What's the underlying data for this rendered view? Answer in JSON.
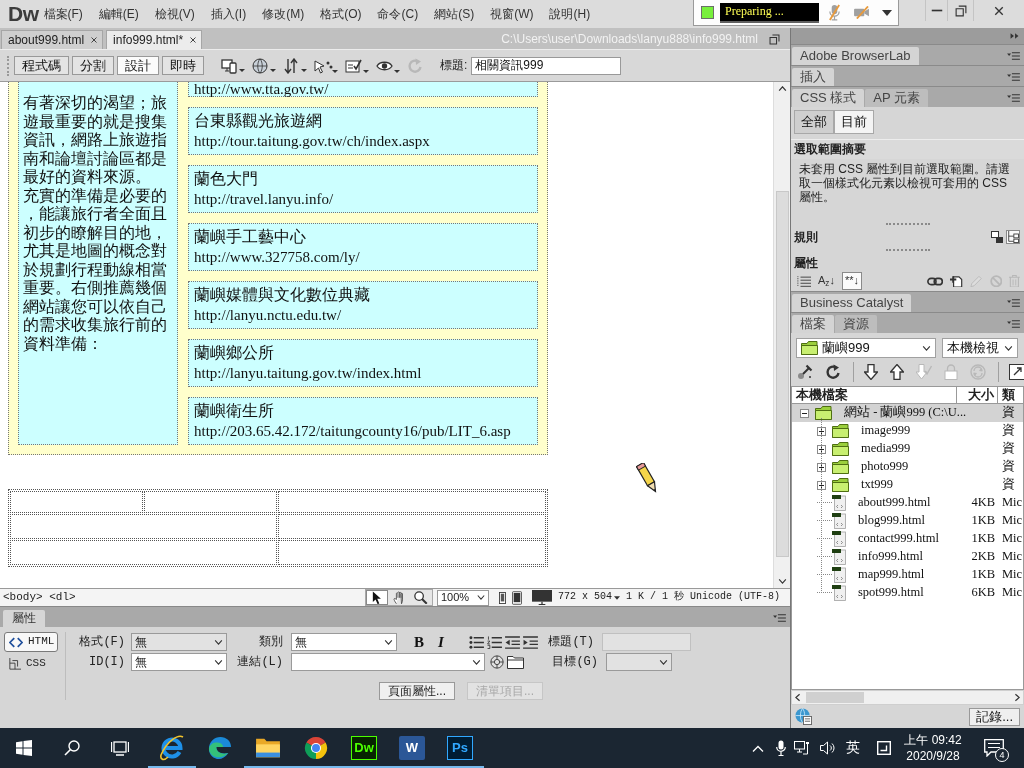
{
  "menubar": {
    "logo": "Dw",
    "items": [
      "檔案(F)",
      "編輯(E)",
      "檢視(V)",
      "插入(I)",
      "修改(M)",
      "格式(O)",
      "命令(C)",
      "網站(S)",
      "視窗(W)",
      "說明(H)"
    ]
  },
  "recorder": {
    "status": "Preparing ..."
  },
  "document_tabs": [
    {
      "label": "about999.html",
      "selected": false
    },
    {
      "label": "info999.html*",
      "selected": true
    }
  ],
  "document_path": "C:\\Users\\user\\Downloads\\lanyu888\\info999.html",
  "document_toolbar": {
    "views": [
      {
        "label": "程式碼",
        "selected": false
      },
      {
        "label": "分割",
        "selected": false
      },
      {
        "label": "設計",
        "selected": true
      },
      {
        "label": "即時",
        "selected": false
      }
    ],
    "tools": [
      {
        "kind": "devices",
        "disabled": false
      },
      {
        "kind": "globe",
        "disabled": false
      },
      {
        "kind": "transfer",
        "disabled": false
      },
      {
        "kind": "inspect",
        "disabled": false
      },
      {
        "kind": "validate",
        "disabled": false
      },
      {
        "kind": "eye",
        "disabled": false
      },
      {
        "kind": "refresh",
        "disabled": true
      }
    ],
    "title_label": "標題:",
    "title_value": "相關資訊999"
  },
  "page": {
    "intro": [
      "有著深切的渴望；旅遊最重要的就是搜集資訊，網路上旅遊指南和論壇討論區都是最好的資料來源。",
      "充實的準備是必要的，能讓旅行者全面且初步的瞭解目的地，尤其是地圖的概念對於規劃行程動線相當重要。右側推薦幾個網站讓您可以依自己的需求收集旅行前的資料準備："
    ],
    "links": [
      {
        "url": "http://www.tta.gov.tw/"
      },
      {
        "title": "台東縣觀光旅遊網",
        "url": "http://tour.taitung.gov.tw/ch/index.aspx"
      },
      {
        "title": "蘭色大門",
        "url": "http://travel.lanyu.info/"
      },
      {
        "title": "蘭嶼手工藝中心",
        "url": "http://www.327758.com/ly/"
      },
      {
        "title": "蘭嶼媒體與文化數位典藏",
        "url": "http://lanyu.nctu.edu.tw/"
      },
      {
        "title": "蘭嶼鄉公所",
        "url": "http://lanyu.taitung.gov.tw/index.html"
      },
      {
        "title": "蘭嶼衛生所",
        "url": "http://203.65.42.172/taitungcounty16/pub/LIT_6.asp"
      }
    ]
  },
  "status_bar": {
    "tag_path": "<body> <dl>",
    "tools": [
      {
        "kind": "pointer",
        "selected": true
      },
      {
        "kind": "hand",
        "selected": false
      },
      {
        "kind": "zoom",
        "selected": false
      }
    ],
    "zoom": "100%",
    "window_size": "772 x 504",
    "stats": "1 K / 1 秒",
    "encoding": "Unicode (UTF-8)"
  },
  "properties": {
    "title": "屬性",
    "modes": [
      {
        "kind": "html",
        "label": "HTML",
        "selected": true
      },
      {
        "kind": "css",
        "label": "CSS",
        "selected": false
      }
    ],
    "format": {
      "label": "格式(F)",
      "value": "無",
      "disabled": true
    },
    "id": {
      "label": "ID(I)",
      "value": "無",
      "disabled": false
    },
    "class": {
      "label": "類別",
      "value": "無"
    },
    "link": {
      "label": "連結(L)"
    },
    "bold": "B",
    "italic": "I",
    "heading": {
      "label": "標題(T)",
      "disabled": true
    },
    "target": {
      "label": "目標(G)",
      "disabled": true
    },
    "buttons": [
      {
        "label": "頁面屬性...",
        "disabled": false
      },
      {
        "label": "清單項目...",
        "disabled": true
      }
    ]
  },
  "panel_headers": [
    "Adobe BrowserLab",
    "插入"
  ],
  "css_panel": {
    "tabs": [
      {
        "label": "CSS 樣式",
        "selected": true
      },
      {
        "label": "AP 元素",
        "selected": false
      }
    ],
    "modes": [
      {
        "label": "全部",
        "selected": false
      },
      {
        "label": "目前",
        "selected": true
      }
    ],
    "summary_title": "選取範圍摘要",
    "summary_text": "未套用 CSS 屬性到目前選取範圍。請選取一個樣式化元素以檢視可套用的 CSS 屬性。",
    "rules_title": "規則",
    "rule_views": [
      {
        "kind": "cascade",
        "selected": false
      },
      {
        "kind": "tree",
        "selected": true
      }
    ],
    "properties_title": "屬性",
    "property_views": [
      {
        "kind": "category",
        "selected": false
      },
      {
        "kind": "alpha",
        "label": "A$_{z}$↓",
        "selected": false
      },
      {
        "kind": "set",
        "label": "**↓",
        "selected": true
      }
    ],
    "property_actions": [
      {
        "kind": "attach",
        "disabled": false
      },
      {
        "kind": "new",
        "disabled": false
      },
      {
        "kind": "edit",
        "disabled": true
      },
      {
        "kind": "disable",
        "disabled": true
      },
      {
        "kind": "delete",
        "disabled": true
      }
    ]
  },
  "bc_header": "Business Catalyst",
  "files_panel": {
    "tabs": [
      {
        "label": "檔案",
        "selected": true
      },
      {
        "label": "資源",
        "selected": false
      }
    ],
    "site": "蘭嶼999",
    "view": "本機檢視",
    "tools": [
      {
        "kind": "connect",
        "disabled": false
      },
      {
        "kind": "refresh",
        "disabled": false
      },
      {
        "kind": "get",
        "disabled": false
      },
      {
        "kind": "put",
        "disabled": false
      },
      {
        "kind": "checkout",
        "disabled": true
      },
      {
        "kind": "checkin",
        "disabled": true
      },
      {
        "kind": "sync",
        "disabled": true
      },
      {
        "kind": "expand",
        "disabled": false
      }
    ],
    "columns": [
      "本機檔案",
      "大小",
      "類"
    ],
    "tree": [
      {
        "kind": "site",
        "name": "網站 - 蘭嶼999 (C:\\U...",
        "type": "資",
        "expanded": true,
        "selected": true,
        "children": [
          {
            "kind": "folder",
            "name": "image999",
            "type": "資",
            "expanded": false,
            "selected": false
          },
          {
            "kind": "folder",
            "name": "media999",
            "type": "資",
            "expanded": false,
            "selected": false
          },
          {
            "kind": "folder",
            "name": "photo999",
            "type": "資",
            "expanded": false,
            "selected": false
          },
          {
            "kind": "folder",
            "name": "txt999",
            "type": "資",
            "expanded": false,
            "selected": false
          },
          {
            "kind": "file",
            "name": "about999.html",
            "size": "4KB",
            "type": "Mic",
            "selected": false
          },
          {
            "kind": "file",
            "name": "blog999.html",
            "size": "1KB",
            "type": "Mic",
            "selected": false
          },
          {
            "kind": "file",
            "name": "contact999.html",
            "size": "1KB",
            "type": "Mic",
            "selected": false
          },
          {
            "kind": "file",
            "name": "info999.html",
            "size": "2KB",
            "type": "Mic",
            "selected": false
          },
          {
            "kind": "file",
            "name": "map999.html",
            "size": "1KB",
            "type": "Mic",
            "selected": false
          },
          {
            "kind": "file",
            "name": "spot999.html",
            "size": "6KB",
            "type": "Mic",
            "selected": false
          }
        ]
      }
    ],
    "log_button": "記錄..."
  },
  "taskbar": {
    "apps": [
      {
        "kind": "ie",
        "running": true
      },
      {
        "kind": "edge",
        "running": false
      },
      {
        "kind": "explorer",
        "running": true
      },
      {
        "kind": "chrome",
        "running": true
      },
      {
        "kind": "dw",
        "label": "Dw",
        "running": true
      },
      {
        "kind": "word",
        "label": "W",
        "running": true
      },
      {
        "kind": "ps",
        "label": "Ps",
        "running": true
      }
    ],
    "ime": "英",
    "time": "上午 09:42",
    "date": "2020/9/28",
    "notifications": "4"
  }
}
